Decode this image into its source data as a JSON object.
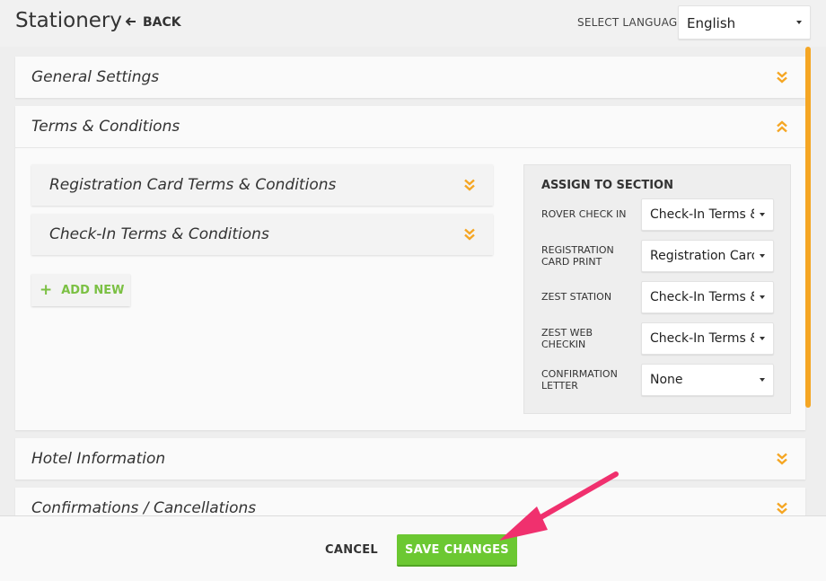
{
  "header": {
    "title": "Stationery",
    "back_label": "BACK",
    "language_label": "SELECT LANGUAGE",
    "language_value": "English"
  },
  "panels": {
    "general_settings": {
      "title": "General Settings",
      "state": "collapsed"
    },
    "terms_conditions": {
      "title": "Terms & Conditions",
      "state": "expanded"
    },
    "hotel_information": {
      "title": "Hotel Information",
      "state": "collapsed"
    },
    "confirmations_cancellations": {
      "title": "Confirmations / Cancellations",
      "state": "collapsed"
    }
  },
  "terms": {
    "items": [
      {
        "title": "Registration Card Terms & Conditions"
      },
      {
        "title": "Check-In Terms & Conditions"
      }
    ],
    "add_new_label": "ADD NEW"
  },
  "assign": {
    "title": "ASSIGN TO SECTION",
    "rows": [
      {
        "label": "ROVER CHECK IN",
        "value": "Check-In Terms & ."
      },
      {
        "label": "REGISTRATION CARD PRINT",
        "value": "Registration Card ."
      },
      {
        "label": "ZEST STATION",
        "value": "Check-In Terms & ."
      },
      {
        "label": "ZEST WEB CHECKIN",
        "value": "Check-In Terms & ."
      },
      {
        "label": "CONFIRMATION LETTER",
        "value": "None"
      }
    ]
  },
  "footer": {
    "cancel_label": "CANCEL",
    "save_label": "SAVE CHANGES"
  },
  "colors": {
    "accent_orange": "#f5a623",
    "save_green": "#6cc832",
    "add_green": "#7bc043",
    "annotation_pink": "#f0306e"
  },
  "icons": {
    "back": "arrow-left-icon",
    "collapsed": "double-chevron-down-icon",
    "expanded": "double-chevron-up-icon",
    "add": "plus-icon",
    "dropdown": "caret-down-icon"
  }
}
